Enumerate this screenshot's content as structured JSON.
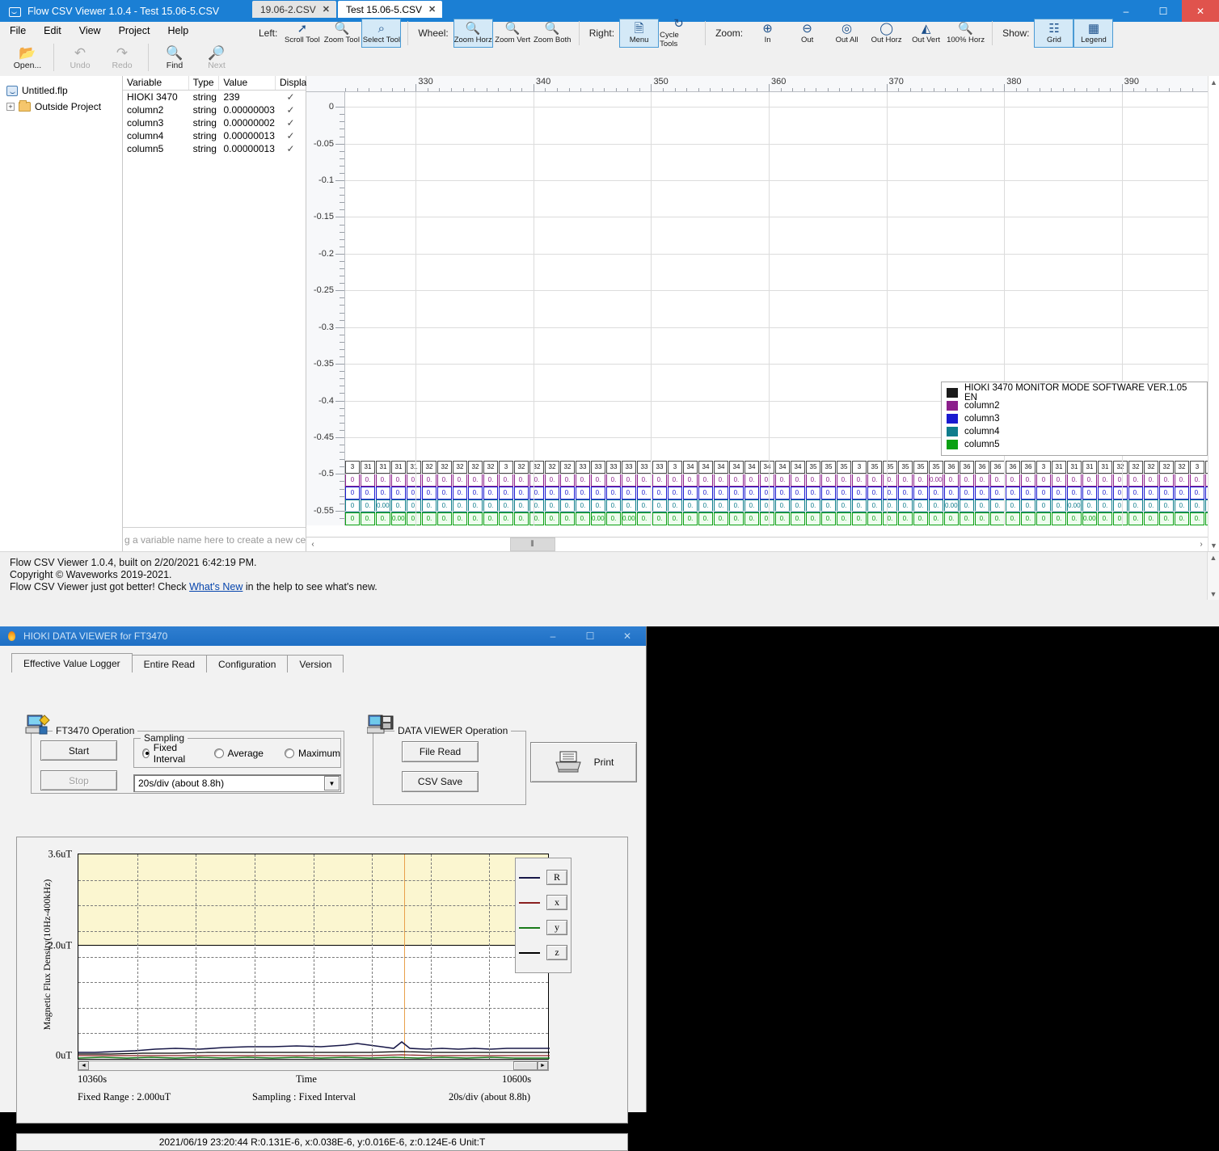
{
  "flow": {
    "title": "Flow CSV Viewer 1.0.4 - Test 15.06-5.CSV",
    "window_buttons": {
      "minimize": "–",
      "maximize": "☐",
      "close": "✕"
    },
    "menu": [
      "File",
      "Edit",
      "View",
      "Project",
      "Help"
    ],
    "toolbar": [
      {
        "label": "Open...",
        "icon": "folder-open-icon",
        "enabled": true
      },
      {
        "label": "Undo",
        "icon": "undo-icon",
        "enabled": false
      },
      {
        "label": "Redo",
        "icon": "redo-icon",
        "enabled": false
      },
      {
        "label": "Find",
        "icon": "binoculars-icon",
        "enabled": true
      },
      {
        "label": "Next",
        "icon": "binoculars-next-icon",
        "enabled": false
      }
    ],
    "project_tree": [
      {
        "label": "Untitled.flp",
        "icon": "flow-project-icon"
      },
      {
        "label": "Outside Project",
        "icon": "folder-icon",
        "expander": "+"
      }
    ],
    "doc_tabs": [
      {
        "label": "19.06-2.CSV",
        "active": false,
        "close": "✕"
      },
      {
        "label": "Test 15.06-5.CSV",
        "active": true,
        "close": "✕"
      }
    ],
    "tool_groups": {
      "left_label": "Left:",
      "left_tools": [
        {
          "label": "Scroll Tool",
          "icon": "cursor-arrow-icon",
          "selected": false
        },
        {
          "label": "Zoom Tool",
          "icon": "magnifier-icon",
          "selected": false
        },
        {
          "label": "Select Tool",
          "icon": "i-beam-icon",
          "selected": true
        }
      ],
      "wheel_label": "Wheel:",
      "wheel_tools": [
        {
          "label": "Zoom Horz",
          "icon": "zoom-horz-icon",
          "selected": true
        },
        {
          "label": "Zoom Vert",
          "icon": "zoom-vert-icon",
          "selected": false
        },
        {
          "label": "Zoom Both",
          "icon": "zoom-both-icon",
          "selected": false
        }
      ],
      "right_label": "Right:",
      "right_tools": [
        {
          "label": "Menu",
          "icon": "menu-doc-icon",
          "selected": true
        },
        {
          "label": "Cycle Tools",
          "icon": "cycle-tools-icon",
          "selected": false
        }
      ],
      "zoom_label": "Zoom:",
      "zoom_tools": [
        {
          "label": "In",
          "icon": "zoom-in-icon",
          "selected": false
        },
        {
          "label": "Out",
          "icon": "zoom-out-icon",
          "selected": false
        },
        {
          "label": "Out All",
          "icon": "zoom-out-all-icon",
          "selected": false
        },
        {
          "label": "Out Horz",
          "icon": "zoom-out-horz-icon",
          "selected": false
        },
        {
          "label": "Out Vert",
          "icon": "zoom-out-vert-icon",
          "selected": false
        },
        {
          "label": "100% Horz",
          "icon": "zoom-100-horz-icon",
          "selected": false
        }
      ],
      "show_label": "Show:",
      "show_tools": [
        {
          "label": "Grid",
          "icon": "grid-icon",
          "selected": true
        },
        {
          "label": "Legend",
          "icon": "legend-icon",
          "selected": true
        }
      ]
    },
    "var_table": {
      "headers": [
        "Variable",
        "Type",
        "Value",
        "Displa"
      ],
      "rows": [
        {
          "variable": "HIOKI 3470",
          "type": "string",
          "value": "239",
          "display": "✓"
        },
        {
          "variable": "column2",
          "type": "string",
          "value": "0.00000003",
          "display": "✓"
        },
        {
          "variable": "column3",
          "type": "string",
          "value": "0.00000002",
          "display": "✓"
        },
        {
          "variable": "column4",
          "type": "string",
          "value": "0.00000013",
          "display": "✓"
        },
        {
          "variable": "column5",
          "type": "string",
          "value": "0.00000013",
          "display": "✓"
        }
      ],
      "footer_hint": "g a variable name here to create a new cel"
    },
    "legend": {
      "entries": [
        {
          "label": "HIOKI 3470 MONITOR MODE SOFTWARE VER.1.05 EN",
          "color": "#1a1a1a"
        },
        {
          "label": "column2",
          "color": "#8b1f8b"
        },
        {
          "label": "column3",
          "color": "#1a1ad0"
        },
        {
          "label": "column4",
          "color": "#0f7d8c"
        },
        {
          "label": "column5",
          "color": "#0aa013"
        }
      ]
    },
    "status": {
      "line1": "Flow CSV Viewer 1.0.4, built on 2/20/2021 6:42:19 PM.",
      "line2": "Copyright © Waveworks 2019-2021.",
      "line3_pre": "Flow CSV Viewer just got better! Check ",
      "line3_link": "What's New",
      "line3_post": " in the help to see what's new."
    },
    "scrollbar": {
      "left_arrow": "‹",
      "right_arrow": "›",
      "thumb_glyph": "⦀"
    }
  },
  "chart_data": {
    "type": "line",
    "title": "",
    "xlabel": "",
    "ylabel": "",
    "x_ticks": [
      330,
      340,
      350,
      360,
      370,
      380,
      390
    ],
    "y_ticks": [
      0,
      -0.05,
      -0.1,
      -0.15,
      -0.2,
      -0.25,
      -0.3,
      -0.35,
      -0.4,
      -0.45,
      -0.5,
      -0.55
    ],
    "ylim": [
      -0.57,
      0.02
    ],
    "xlim": [
      324,
      396
    ],
    "grid": true,
    "legend_position": "bottom-right",
    "series": [
      {
        "name": "HIOKI 3470 MONITOR MODE SOFTWARE VER.1.05 EN",
        "color": "#1a1a1a",
        "row": "values",
        "sample_values": [
          "3",
          "31",
          "31",
          "31",
          "31",
          "32",
          "32",
          "32",
          "32",
          "32",
          "3",
          "32",
          "32",
          "32",
          "32",
          "33",
          "33",
          "33",
          "33",
          "33",
          "33",
          "3",
          "34",
          "34",
          "34",
          "34",
          "34",
          "34",
          "34",
          "34",
          "35",
          "35",
          "35",
          "3",
          "35",
          "35",
          "35",
          "35",
          "35",
          "36",
          "36",
          "36",
          "36",
          "36",
          "36"
        ]
      },
      {
        "name": "column2",
        "color": "#8b1f8b",
        "row": "values",
        "sample_values": [
          "0",
          "0.",
          "0.",
          "0.",
          "0.",
          "0.",
          "0.",
          "0.",
          "0.",
          "0.",
          "0.",
          "0.",
          "0.",
          "0.",
          "0.",
          "0.",
          "0.",
          "0.",
          "0.",
          "0.",
          "0.",
          "0.",
          "0.",
          "0.",
          "0.",
          "0.",
          "0.",
          "0.",
          "0.",
          "0.",
          "0.",
          "0.",
          "0.",
          "0.",
          "0.",
          "0.",
          "0.",
          "0.",
          "0.000",
          "0.",
          "0.",
          "0.",
          "0.",
          "0.",
          "0."
        ]
      },
      {
        "name": "column3",
        "color": "#1a1ad0",
        "row": "values",
        "sample_values": [
          "0",
          "0.",
          "0.",
          "0.",
          "0.",
          "0.",
          "0.",
          "0.",
          "0.",
          "0.",
          "0.",
          "0.",
          "0.",
          "0.",
          "0.",
          "0.",
          "0.",
          "0.",
          "0.",
          "0.",
          "0.",
          "0.",
          "0.",
          "0.",
          "0.",
          "0.",
          "0.",
          "0.",
          "0.",
          "0.",
          "0.",
          "0.",
          "0.",
          "0.",
          "0.",
          "0.",
          "0.",
          "0.",
          "0.",
          "0.",
          "0.",
          "0.",
          "0.",
          "0.",
          "0."
        ]
      },
      {
        "name": "column4",
        "color": "#0f7d8c",
        "row": "values",
        "sample_values": [
          "0",
          "0.",
          "0.000",
          "0.",
          "0.",
          "0.",
          "0.",
          "0.",
          "0.",
          "0.",
          "0.",
          "0.",
          "0.",
          "0.",
          "0.",
          "0.",
          "0.",
          "0.",
          "0.",
          "0.",
          "0.",
          "0.",
          "0.",
          "0.",
          "0.",
          "0.",
          "0.",
          "0.",
          "0.",
          "0.",
          "0.",
          "0.",
          "0.",
          "0.",
          "0.",
          "0.",
          "0.",
          "0.",
          "0.",
          "0.000",
          "0.",
          "0.",
          "0.",
          "0.",
          "0."
        ]
      },
      {
        "name": "column5",
        "color": "#0aa013",
        "row": "values",
        "sample_values": [
          "0",
          "0.",
          "0.",
          "0.000",
          "0.",
          "0.",
          "0.",
          "0.",
          "0.",
          "0.",
          "0.",
          "0.",
          "0.",
          "0.",
          "0.",
          "0.",
          "0.000",
          "0.",
          "0.000",
          "0.",
          "0.",
          "0.",
          "0.",
          "0.",
          "0.",
          "0.",
          "0.",
          "0.",
          "0.",
          "0.",
          "0.",
          "0.",
          "0.",
          "0.",
          "0.",
          "0.",
          "0.",
          "0.",
          "0.",
          "0.",
          "0.",
          "0.",
          "0.",
          "0.",
          "0."
        ]
      }
    ]
  },
  "hioki": {
    "title": "HIOKI DATA VIEWER for FT3470",
    "window_buttons": {
      "minimize": "–",
      "maximize": "☐",
      "close": "✕"
    },
    "tabs": [
      {
        "label": "Effective Value Logger",
        "active": true
      },
      {
        "label": "Entire Read",
        "active": false
      },
      {
        "label": "Configuration",
        "active": false
      },
      {
        "label": "Version",
        "active": false
      }
    ],
    "ft3470": {
      "group_title": "FT3470 Operation",
      "start_label": "Start",
      "stop_label": "Stop",
      "sampling_title": "Sampling",
      "radios": [
        {
          "label": "Fixed Interval",
          "selected": true
        },
        {
          "label": "Average",
          "selected": false
        },
        {
          "label": "Maximum",
          "selected": false
        }
      ],
      "interval_value": "20s/div (about 8.8h)",
      "interval_arrow": "▼"
    },
    "dataviewer": {
      "group_title": "DATA VIEWER Operation",
      "file_read_label": "File Read",
      "csv_save_label": "CSV Save"
    },
    "print": {
      "label": "Print",
      "icon": "printer-icon"
    },
    "graph": {
      "ylabel": "Magnetic Flux Density(10Hz-400kHz)",
      "y_ticks": [
        "3.6uT",
        "2.0uT",
        "0uT"
      ],
      "x_left": "10360s",
      "x_center": "Time",
      "x_right": "10600s",
      "footer_left": "Fixed Range : 2.000uT",
      "footer_center": "Sampling : Fixed Interval",
      "footer_right": "20s/div (about 8.8h)",
      "legend": [
        {
          "key": "R",
          "color": "#181848"
        },
        {
          "key": "x",
          "color": "#8a2020"
        },
        {
          "key": "y",
          "color": "#1a7a1a"
        },
        {
          "key": "z",
          "color": "#000000"
        }
      ],
      "scroll": {
        "left": "◄",
        "right": "►"
      }
    },
    "statusbar": "2021/06/19  23:20:44   R:0.131E-6, x:0.038E-6, y:0.016E-6, z:0.124E-6   Unit:T"
  },
  "hioki_chart_data": {
    "type": "line",
    "title": "",
    "ylabel": "Magnetic Flux Density(10Hz-400kHz)",
    "xlabel": "Time",
    "ylim": [
      0,
      3.6
    ],
    "y_ticks": [
      0,
      2.0,
      3.6
    ],
    "y_tick_labels": [
      "0uT",
      "2.0uT",
      "3.6uT"
    ],
    "xlim": [
      10360,
      10600
    ],
    "x_tick_labels": [
      "10360s",
      "10600s"
    ],
    "grid": true,
    "legend_position": "right",
    "series": [
      {
        "name": "R",
        "color": "#181848",
        "approx_level_uT": 0.13
      },
      {
        "name": "x",
        "color": "#8a2020",
        "approx_level_uT": 0.04
      },
      {
        "name": "y",
        "color": "#1a7a1a",
        "approx_level_uT": 0.02
      },
      {
        "name": "z",
        "color": "#000000",
        "approx_level_uT": 0.12
      }
    ],
    "cursor_time_s": 10520,
    "readout": {
      "R": "0.131E-6",
      "x": "0.038E-6",
      "y": "0.016E-6",
      "z": "0.124E-6",
      "unit": "T"
    }
  }
}
